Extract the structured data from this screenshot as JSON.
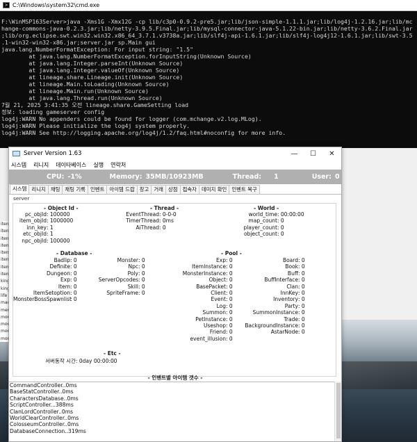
{
  "cmd": {
    "title": "C:\\Windows\\system32\\cmd.exe",
    "lines": [
      "F:\\WinMSP163Server>java -Xms1G -Xmx12G -cp lib/c3p0-0.9.2-pre5.jar;lib/json-simple-1.1.1.jar;lib/log4j-1.2.16.jar;lib/mc",
      "hange-commons-java-0.2.3.jar;lib/netty-3.9.5.Final.jar;lib/mysql-connector-java-5.1.22-bin.jar;lib/netty-3.6.2.Final.jar",
      ";lib/org.eclipse.swt.win32.win32.x86_64_3.7.1.v3738a.jar;lib/slf4j-api-1.6.1.jar;lib/slf4j-log4j12-1.6.1.jar;lib/swt-3.5",
      ".1-win32-win32-x86.jar;server.jar sp.Main gui",
      "java.lang.NumberFormatException: For input string: \"1.5\"",
      "        at java.lang.NumberFormatException.forInputString(Unknown Source)",
      "        at java.lang.Integer.parseInt(Unknown Source)",
      "        at java.lang.Integer.valueOf(Unknown Source)",
      "        at lineage.share.Lineage.init(Unknown Source)",
      "        at lineage.Main.toLoading(Unknown Source)",
      "        at lineage.Main.run(Unknown Source)",
      "        at java.lang.Thread.run(Unknown Source)",
      "7월 21, 2025 3:41:35 오전 lineage.share.GameSetting load",
      "정보: loading gameserver config",
      "log4j:WARN No appenders could be found for logger (com.mchange.v2.log.MLog).",
      "log4j:WARN Please initialize the log4j system properly.",
      "log4j:WARN See http://logging.apache.org/log4j/1.2/faq.html#noconfig for more info."
    ]
  },
  "behind_list": [
    "iten",
    "iten",
    "iten",
    "iten",
    "iten",
    "iten",
    "iten",
    "iten",
    "king",
    "king",
    "life",
    "mac",
    "mer",
    "mor",
    "mor",
    "mor",
    "mor"
  ],
  "server": {
    "title": "Server Version 1.63",
    "menu": [
      "시스템",
      "리니지",
      "데이타베이스",
      "실행",
      "연락처"
    ],
    "status": {
      "cpu_label": "CPU:",
      "cpu_value": "-1%",
      "memory_label": "Memory:",
      "memory_value": "35MB/10923MB",
      "thread_label": "Thread:",
      "thread_value": "1",
      "user_label": "User:",
      "user_value": "0"
    },
    "tabs": [
      "시스템",
      "리니지",
      "채팅",
      "채팅 기록",
      "인벤트",
      "아이템 드랍",
      "창고",
      "거래",
      "상점",
      "접속자",
      "데미지 확인",
      "인벤트 복구"
    ],
    "panel_label": "server",
    "object_id": {
      "title": "- Object Id -",
      "labels": [
        "pc_objId",
        "item_objId",
        "inn_key",
        "etc_objId",
        "npc_objId"
      ],
      "values": [
        ": 100000",
        ": 1000000",
        ": 1",
        ": 1",
        ": 100000"
      ]
    },
    "thread": {
      "title": "- Thread -",
      "labels": [
        "EventThread",
        "TimerThread",
        "AiThread"
      ],
      "values": [
        ": 0-0-0",
        ": 0ms",
        ": 0"
      ]
    },
    "world": {
      "title": "- World -",
      "labels": [
        "world_time",
        "map_count",
        "player_count",
        "object_count"
      ],
      "values": [
        ": 00:00:00",
        ": 0",
        ": 0",
        ": 0"
      ]
    },
    "database": {
      "title": "- Database -",
      "col1": [
        {
          "label": "Badlip",
          "value": ": 0"
        },
        {
          "label": "Definite",
          "value": ": 0"
        },
        {
          "label": "Dungeon",
          "value": ": 0"
        },
        {
          "label": "Exp",
          "value": ": 0"
        },
        {
          "label": "Item",
          "value": ": 0"
        },
        {
          "label": "ItemSetoption",
          "value": ": 0"
        },
        {
          "label": "MonsterBossSpawnlist",
          "value": ": 0"
        }
      ],
      "col2": [
        {
          "label": "Monster",
          "value": ": 0"
        },
        {
          "label": "Npc",
          "value": ": 0"
        },
        {
          "label": "Poly",
          "value": ": 0"
        },
        {
          "label": "ServerOpcodes",
          "value": ": 0"
        },
        {
          "label": "Skill",
          "value": ": 0"
        },
        {
          "label": "SpriteFrame",
          "value": ": 0"
        }
      ]
    },
    "pool": {
      "title": "- Pool -",
      "col1": [
        {
          "label": "Exp",
          "value": ": 0"
        },
        {
          "label": "ItemInstance",
          "value": ": 0"
        },
        {
          "label": "MonsterInstance",
          "value": ": 0"
        },
        {
          "label": "Object",
          "value": ": 0"
        },
        {
          "label": "BasePacket",
          "value": ": 0"
        },
        {
          "label": "Client",
          "value": ": 0"
        },
        {
          "label": "Event",
          "value": ": 0"
        },
        {
          "label": "Log",
          "value": ": 0"
        },
        {
          "label": "Summon",
          "value": ": 0"
        },
        {
          "label": "PetInstance",
          "value": ": 0"
        },
        {
          "label": "Useshop",
          "value": ": 0"
        },
        {
          "label": "Friend",
          "value": ": 0"
        },
        {
          "label": "event_illusion",
          "value": ": 0"
        }
      ],
      "col2": [
        {
          "label": "Board",
          "value": ": 0"
        },
        {
          "label": "Book",
          "value": ": 0"
        },
        {
          "label": "Buff",
          "value": ": 0"
        },
        {
          "label": "BuffInterface",
          "value": ": 0"
        },
        {
          "label": "Clan",
          "value": ": 0"
        },
        {
          "label": "InnKey",
          "value": ": 0"
        },
        {
          "label": "Inventory",
          "value": ": 0"
        },
        {
          "label": "Party",
          "value": ": 0"
        },
        {
          "label": "SummonInstance",
          "value": ": 0"
        },
        {
          "label": "Trade",
          "value": ": 0"
        },
        {
          "label": "BackgroundInstance",
          "value": ": 0"
        },
        {
          "label": "AstarNode",
          "value": ": 0"
        }
      ]
    },
    "etc": {
      "title": "- Etc -",
      "label": "서버동작 시간",
      "value": ": 0day 00:00:00"
    },
    "item_count_title": "- 인벤트별 아이템 갯수 -",
    "log_list": [
      "CommandController..0ms",
      "BaseStatController..0ms",
      "CharactersDatabase..0ms",
      "ScriptController...388ms",
      "ClanLordController..0ms",
      "WorldClearController..0ms",
      "ColosseumController..0ms",
      "DatabaseConnection..319ms"
    ]
  }
}
